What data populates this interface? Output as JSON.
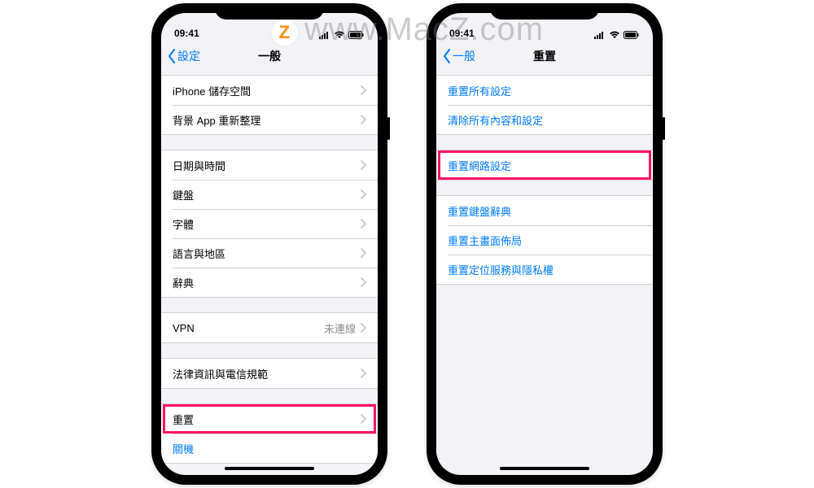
{
  "watermark_text": "www.MacZ.com",
  "watermark_letter": "Z",
  "status": {
    "time": "09:41"
  },
  "left_phone": {
    "back_label": "設定",
    "title": "一般",
    "group1": [
      {
        "label": "iPhone 儲存空間"
      },
      {
        "label": "背景 App 重新整理"
      }
    ],
    "group2": [
      {
        "label": "日期與時間"
      },
      {
        "label": "鍵盤"
      },
      {
        "label": "字體"
      },
      {
        "label": "語言與地區"
      },
      {
        "label": "辭典"
      }
    ],
    "group3": [
      {
        "label": "VPN",
        "value": "未連線"
      }
    ],
    "group4": [
      {
        "label": "法律資訊與電信規範"
      }
    ],
    "group5": [
      {
        "label": "重置"
      },
      {
        "label": "關機"
      }
    ]
  },
  "right_phone": {
    "back_label": "一般",
    "title": "重置",
    "group1": [
      {
        "label": "重置所有設定"
      },
      {
        "label": "清除所有內容和設定"
      }
    ],
    "group2": [
      {
        "label": "重置網路設定"
      }
    ],
    "group3": [
      {
        "label": "重置鍵盤辭典"
      },
      {
        "label": "重置主畫面佈局"
      },
      {
        "label": "重置定位服務與隱私權"
      }
    ]
  }
}
